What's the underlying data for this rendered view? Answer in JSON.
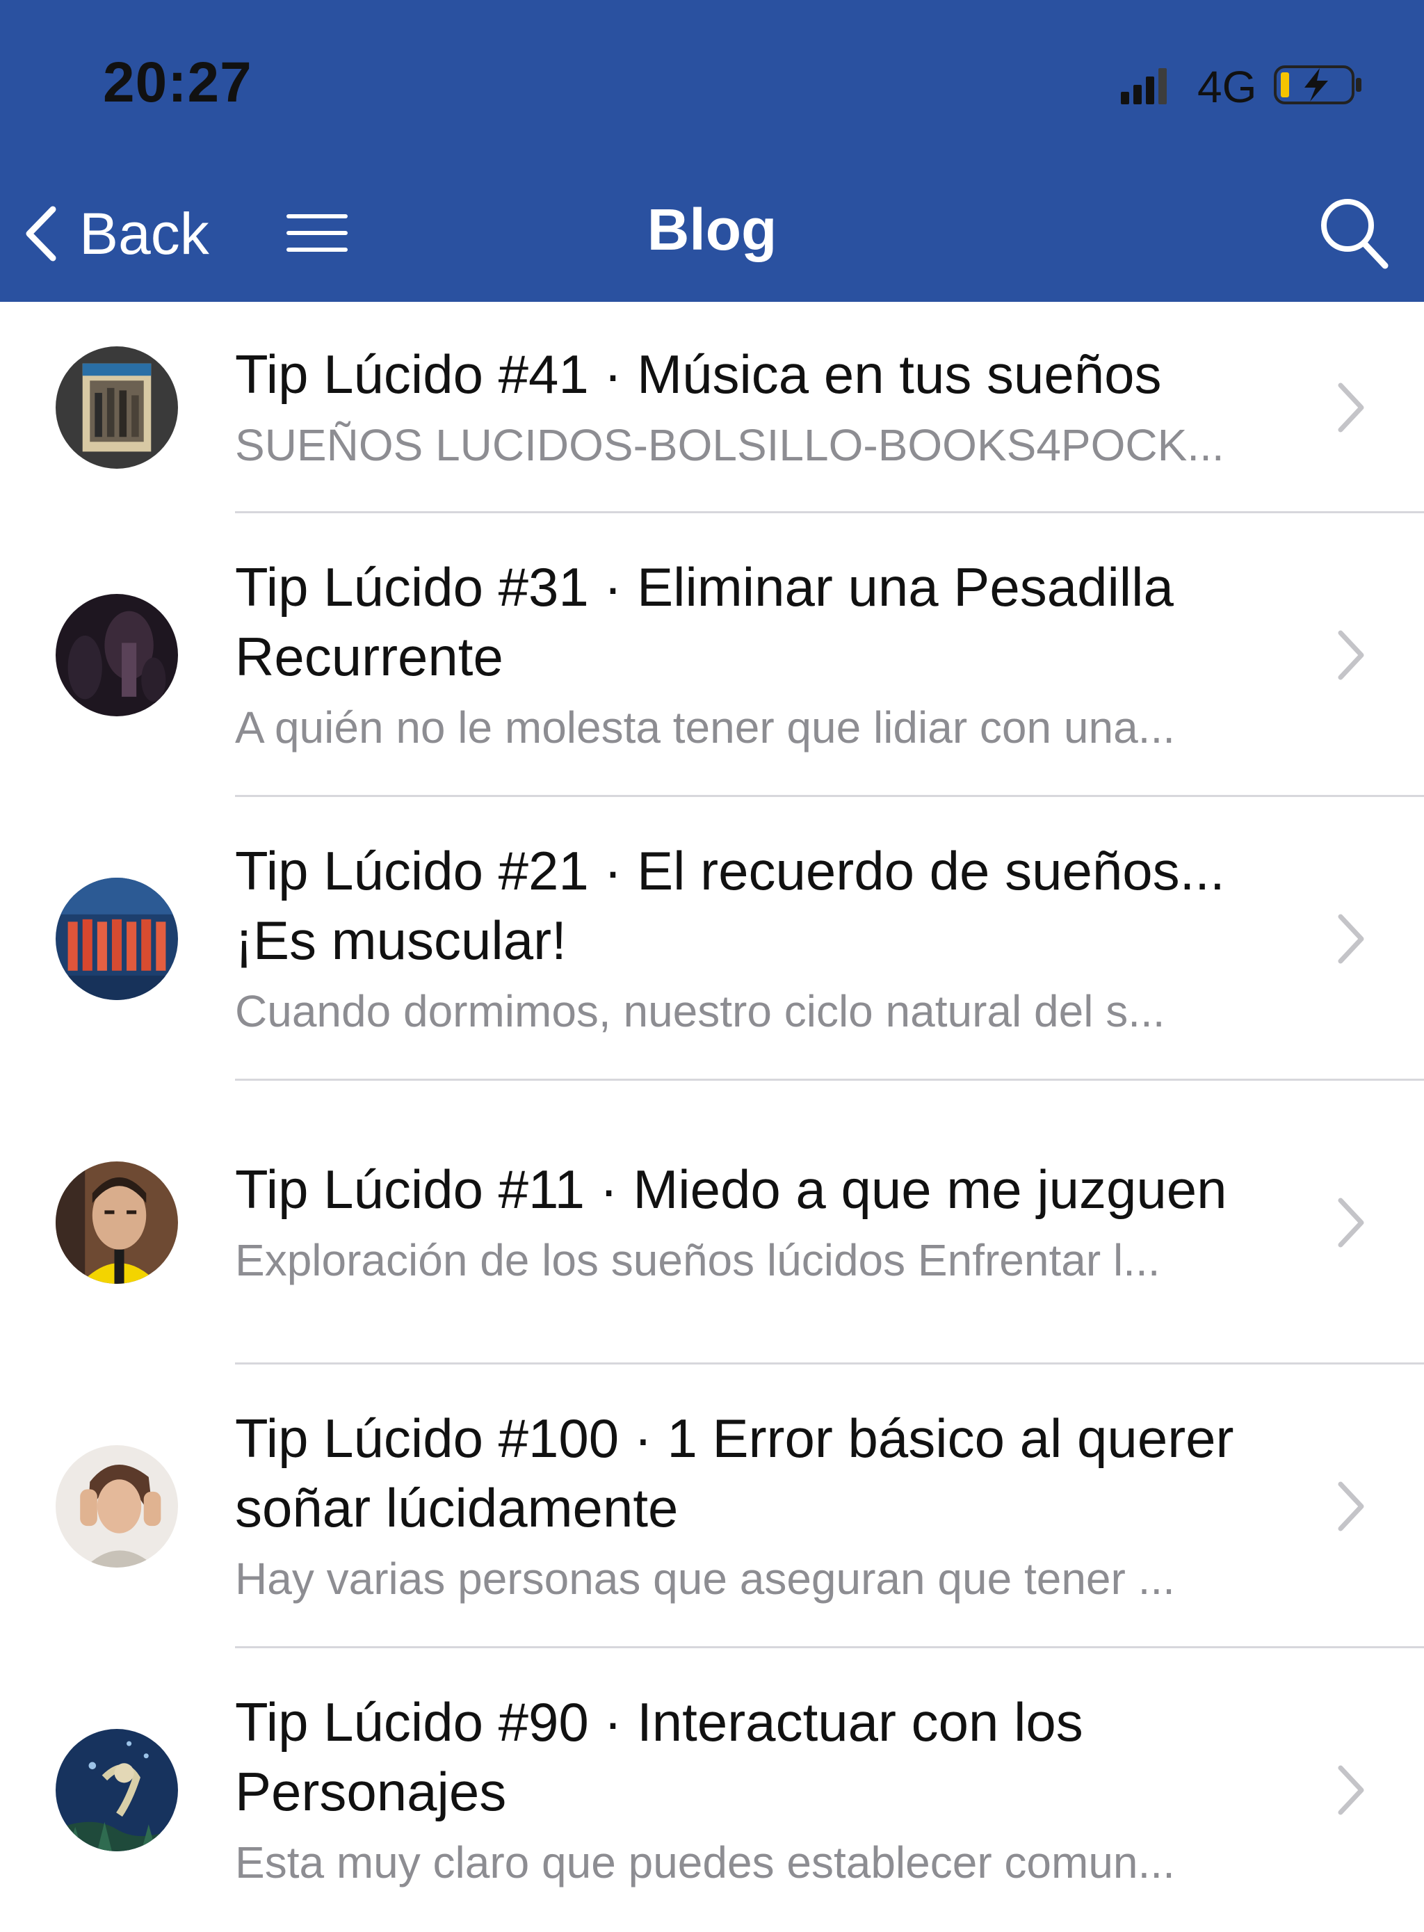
{
  "status_bar": {
    "time": "20:27",
    "network": "4G"
  },
  "nav_bar": {
    "back_label": "Back",
    "title": "Blog"
  },
  "posts": [
    {
      "title": "Tip Lúcido #41 · Música en tus sueños",
      "subtitle": "SUEÑOS LUCIDOS-BOLSILLO-BOOKS4POCK..."
    },
    {
      "title": "Tip Lúcido #31 · Eliminar una Pesadilla Recurrente",
      "subtitle": "A quién no le molesta tener que lidiar con una..."
    },
    {
      "title": "Tip Lúcido #21 · El recuerdo de sueños... ¡Es muscular!",
      "subtitle": "Cuando dormimos, nuestro ciclo natural del s..."
    },
    {
      "title": "Tip Lúcido #11 · Miedo a que me juzguen",
      "subtitle": "Exploración de los sueños lúcidos Enfrentar l..."
    },
    {
      "title": "Tip Lúcido #100 · 1 Error básico al querer soñar lúcidamente",
      "subtitle": "Hay varias personas que aseguran que tener ..."
    },
    {
      "title": "Tip Lúcido #90 · Interactuar con los Personajes",
      "subtitle": "Esta muy claro que puedes establecer comun..."
    }
  ],
  "colors": {
    "header_blue": "#2a51a0",
    "battery_yellow": "#f5c400"
  }
}
